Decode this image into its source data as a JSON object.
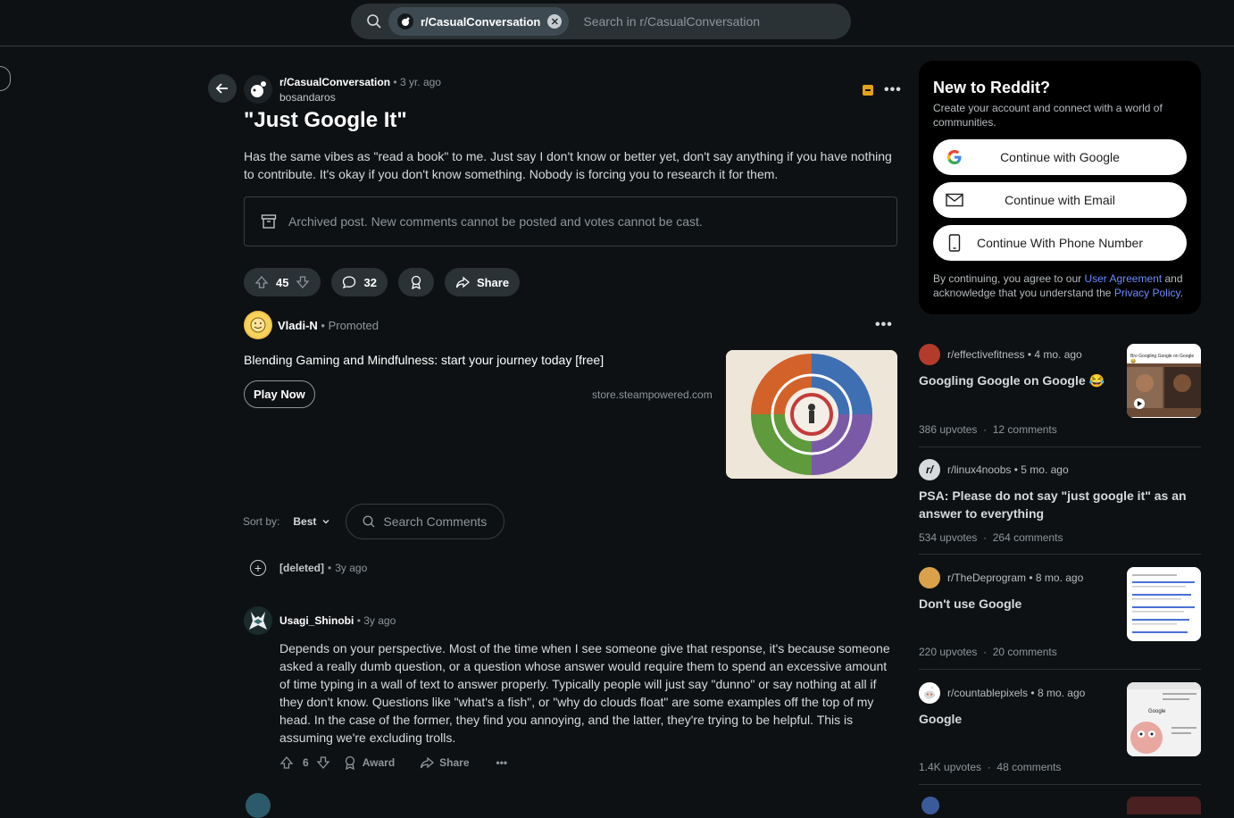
{
  "search": {
    "chip_label": "r/CasualConversation",
    "placeholder": "Search in r/CasualConversation"
  },
  "post": {
    "subreddit": "r/CasualConversation",
    "age": "3 yr. ago",
    "author": "bosandaros",
    "title": "\"Just Google It\"",
    "body": "Has the same vibes as \"read a book\" to me. Just say I don't know or better yet, don't say anything if you have nothing to contribute. It's okay if you don't know something. Nobody is forcing you to research it for them.",
    "archived_notice": "Archived post. New comments cannot be posted and votes cannot be cast.",
    "upvotes": "45",
    "comments": "32",
    "share_label": "Share"
  },
  "promo": {
    "advertiser": "Vladi-N",
    "promoted_label": "Promoted",
    "text": "Blending Gaming and Mindfulness: start your journey today [free]",
    "cta": "Play Now",
    "domain": "store.steampowered.com"
  },
  "comments_section": {
    "sort_label": "Sort by:",
    "sort_value": "Best",
    "search_placeholder": "Search Comments",
    "deleted": {
      "author": "[deleted]",
      "age": "3y ago"
    },
    "comment": {
      "author": "Usagi_Shinobi",
      "age": "3y ago",
      "body": "Depends on your perspective. Most of the time when I see someone give that response, it's because someone asked a really dumb question, or a question whose answer would require them to spend an excessive amount of time typing in a wall of text to answer properly. Typically people will just say \"dunno\" or say nothing at all if they don't know. Questions like \"what's a fish\", or \"why do clouds float\" are some examples off the top of my head. In the case of the former, they find you annoying, and the latter, they're trying to be helpful. This is assuming we're excluding trolls.",
      "votes": "6",
      "award_label": "Award",
      "share_label": "Share"
    }
  },
  "sidebar": {
    "signup": {
      "title": "New to Reddit?",
      "subtitle": "Create your account and connect with a world of communities.",
      "google": "Continue with Google",
      "email": "Continue with Email",
      "phone": "Continue With Phone Number",
      "legal_prefix": "By continuing, you agree to our ",
      "user_agreement": "User Agreement",
      "legal_mid": " and acknowledge that you understand the ",
      "privacy": "Privacy Policy",
      "legal_suffix": "."
    },
    "related": [
      {
        "subreddit": "r/effectivefitness",
        "age": "4 mo. ago",
        "title": "Googling Google on Google 😂",
        "upvotes": "386 upvotes",
        "comments": "12 comments",
        "thumb_text": "Bro Googling Google on Google 😂"
      },
      {
        "subreddit": "r/linux4noobs",
        "age": "5 mo. ago",
        "title": "PSA: Please do not say \"just google it\" as an answer to everything",
        "upvotes": "534 upvotes",
        "comments": "264 comments"
      },
      {
        "subreddit": "r/TheDeprogram",
        "age": "8 mo. ago",
        "title": "Don't use Google",
        "upvotes": "220 upvotes",
        "comments": "20 comments"
      },
      {
        "subreddit": "r/countablepixels",
        "age": "8 mo. ago",
        "title": "Google",
        "upvotes": "1.4K upvotes",
        "comments": "48 comments",
        "thumb_text": "Google"
      }
    ],
    "stat_separator": "·"
  },
  "colors": {
    "background": "#0e1113",
    "surface": "#2a3236",
    "link": "#6d8cff",
    "archive_badge": "#e3a21a"
  }
}
